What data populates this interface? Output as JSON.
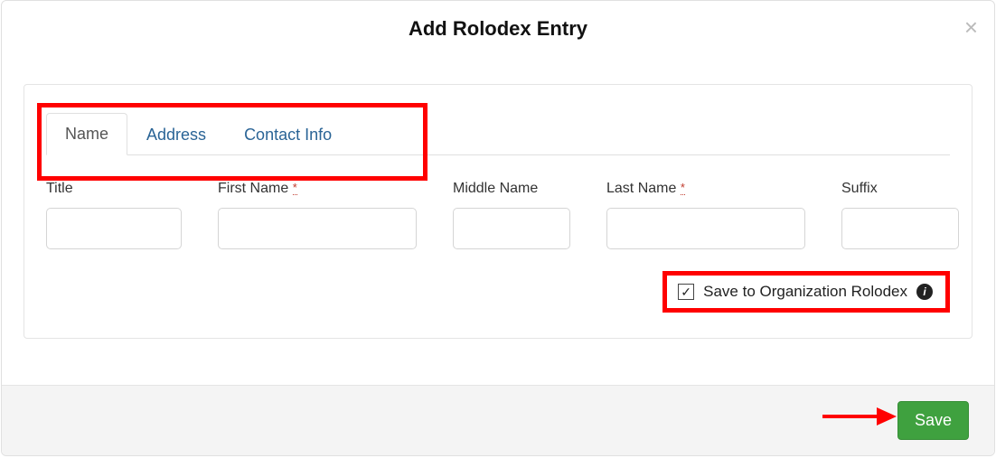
{
  "modal": {
    "title": "Add Rolodex Entry"
  },
  "tabs": {
    "name": "Name",
    "address": "Address",
    "contact": "Contact Info"
  },
  "fields": {
    "title_label": "Title",
    "first_label": "First Name",
    "middle_label": "Middle Name",
    "last_label": "Last Name",
    "suffix_label": "Suffix",
    "required_mark": "*"
  },
  "checkbox": {
    "label": "Save to Organization Rolodex",
    "checked_glyph": "✓",
    "info_glyph": "i"
  },
  "footer": {
    "save_label": "Save"
  }
}
